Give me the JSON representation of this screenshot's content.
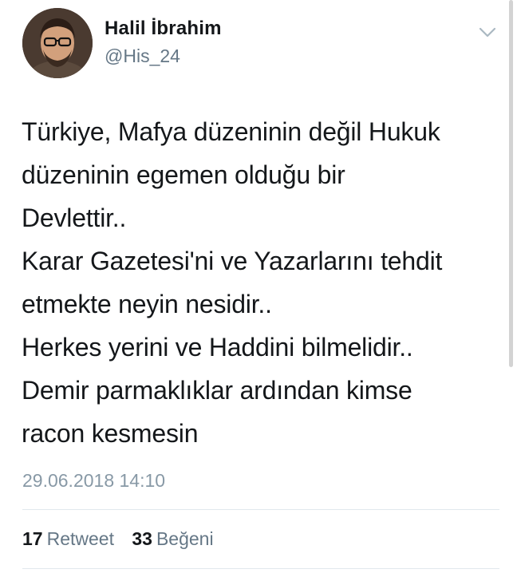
{
  "author": {
    "display_name": "Halil İbrahim",
    "handle": "@His_24"
  },
  "tweet": {
    "lines": [
      "Türkiye, Mafya düzeninin değil Hukuk",
      "düzeninin egemen olduğu bir",
      "Devlettir..",
      "Karar Gazetesi'ni ve Yazarlarını tehdit",
      "etmekte neyin nesidir..",
      "Herkes yerini ve Haddini bilmelidir..",
      "Demir parmaklıklar ardından kimse",
      "racon kesmesin"
    ],
    "timestamp": "29.06.2018 14:10"
  },
  "stats": {
    "retweet_count": "17",
    "retweet_label": "Retweet",
    "like_count": "33",
    "like_label": "Beğeni"
  },
  "icons": {
    "menu": "chevron-down-icon"
  },
  "colors": {
    "text": "#14171a",
    "secondary": "#657786",
    "timestamp": "#8899a6",
    "divider": "#e1e8ed"
  }
}
